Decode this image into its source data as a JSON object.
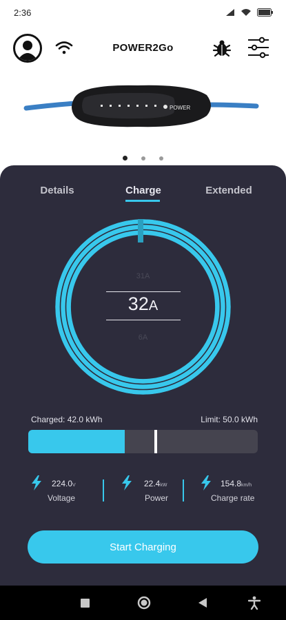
{
  "status_bar": {
    "time": "2:36",
    "battery_icon": "battery-icon",
    "wifi_icon": "wifi-icon",
    "signal_icon": "signal-icon"
  },
  "header": {
    "title": "POWER2Go",
    "avatar_icon": "user-avatar-icon",
    "wifi_icon": "wifi-icon",
    "bug_icon": "bug-icon",
    "settings_icon": "sliders-icon"
  },
  "device": {
    "brand_label": "POWER",
    "carousel": {
      "pages": 3,
      "active": 1
    }
  },
  "tabs": [
    {
      "label": "Details"
    },
    {
      "label": "Charge"
    },
    {
      "label": "Extended"
    }
  ],
  "active_tab": "Charge",
  "amperage": {
    "previous": "31A",
    "current_value": "32",
    "current_unit": "A",
    "next": "6A"
  },
  "charge": {
    "charged_label": "Charged: 42.0 kWh",
    "limit_label": "Limit: 50.0 kWh",
    "fill_fraction": 0.42,
    "limit_fraction": 0.55
  },
  "metrics": [
    {
      "value": "224.0",
      "unit": "V",
      "label": "Voltage"
    },
    {
      "value": "22.4",
      "unit": "kW",
      "label": "Power"
    },
    {
      "value": "154.8",
      "unit": "km/h",
      "label": "Charge rate"
    }
  ],
  "start_button": {
    "label": "Start Charging"
  },
  "colors": {
    "accent": "#38c8ec",
    "panel": "#2d2c3c",
    "track": "#45444f"
  },
  "nav_bar": {
    "recents_icon": "square-icon",
    "home_icon": "circle-icon",
    "back_icon": "triangle-back-icon",
    "accessibility_icon": "accessibility-icon"
  }
}
